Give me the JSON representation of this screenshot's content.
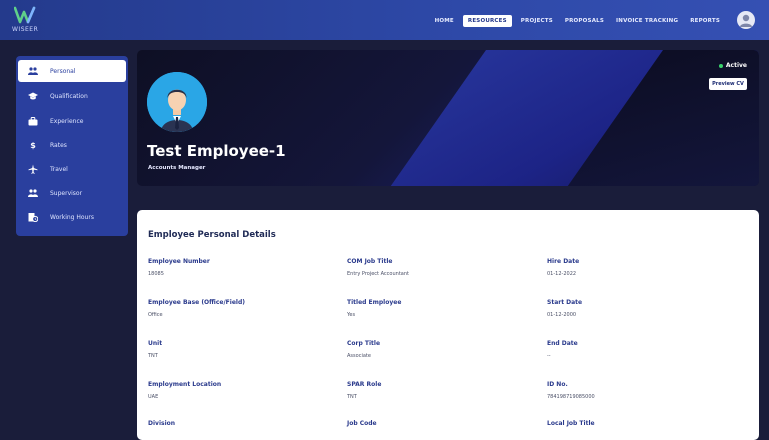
{
  "brand": {
    "logo_text": "WISEER"
  },
  "nav": {
    "items": [
      "HOME",
      "RESOURCES",
      "PROJECTS",
      "PROPOSALS",
      "INVOICE TRACKING",
      "REPORTS"
    ],
    "active": "RESOURCES"
  },
  "sidebar": {
    "items": [
      {
        "label": "Personal",
        "icon": "people-icon",
        "active": true
      },
      {
        "label": "Qualification",
        "icon": "graduation-cap-icon",
        "active": false
      },
      {
        "label": "Experience",
        "icon": "briefcase-icon",
        "active": false
      },
      {
        "label": "Rates",
        "icon": "dollar-icon",
        "active": false
      },
      {
        "label": "Travel",
        "icon": "airplane-icon",
        "active": false
      },
      {
        "label": "Supervisor",
        "icon": "supervisor-icon",
        "active": false
      },
      {
        "label": "Working Hours",
        "icon": "building-clock-icon",
        "active": false
      }
    ]
  },
  "profile": {
    "name": "Test Employee-1",
    "role": "Accounts Manager",
    "status": "Active",
    "preview_button": "Preview CV"
  },
  "details": {
    "title": "Employee Personal Details",
    "fields": [
      {
        "label": "Employee Number",
        "value": "18085"
      },
      {
        "label": "COM Job Title",
        "value": "Entry Project Accountant"
      },
      {
        "label": "Hire Date",
        "value": "01-12-2022"
      },
      {
        "label": "Employee Base (Office/Field)",
        "value": "Office"
      },
      {
        "label": "Titled Employee",
        "value": "Yes"
      },
      {
        "label": "Start Date",
        "value": "01-12-2000"
      },
      {
        "label": "Unit",
        "value": "TNT"
      },
      {
        "label": "Corp Title",
        "value": "Associate"
      },
      {
        "label": "End Date",
        "value": "--"
      },
      {
        "label": "Employment Location",
        "value": "UAE"
      },
      {
        "label": "SPAR Role",
        "value": "TNT"
      },
      {
        "label": "ID No.",
        "value": "784198719085000"
      },
      {
        "label": "Division",
        "value": ""
      },
      {
        "label": "Job Code",
        "value": ""
      },
      {
        "label": "Local Job Title",
        "value": ""
      }
    ]
  },
  "colors": {
    "nav_bg": "#2e49a8",
    "sidebar_bg": "#2a3f9e",
    "status_dot": "#39d26b",
    "avatar_bg": "#2aa6e6"
  }
}
